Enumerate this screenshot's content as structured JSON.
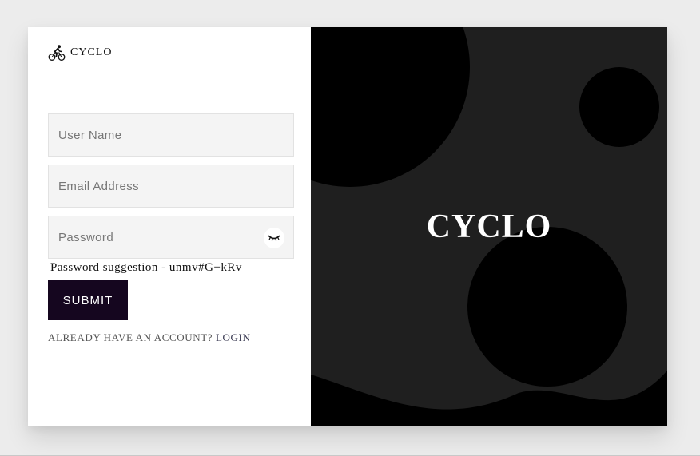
{
  "brand": {
    "name": "CYCLO",
    "logo_icon": "cyclist-icon"
  },
  "form": {
    "username": {
      "placeholder": "User Name",
      "value": ""
    },
    "email": {
      "placeholder": "Email Address",
      "value": ""
    },
    "password": {
      "placeholder": "Password",
      "value": "",
      "toggle_icon": "eye-closed-icon"
    },
    "suggestion_text": "Password suggestion - unmv#G+kRv",
    "submit_label": "SUBMIT",
    "already_text": "ALREADY HAVE AN ACCOUNT?",
    "login_link": "LOGIN"
  },
  "hero": {
    "title": "CYCLO"
  },
  "colors": {
    "page_background": "#ececec",
    "card_left": "#ffffff",
    "field_background": "#f4f4f4",
    "submit_button": "#15061f",
    "hero_background": "#1f1f1f",
    "hero_shapes": "#000000",
    "hero_title": "#ffffff"
  }
}
